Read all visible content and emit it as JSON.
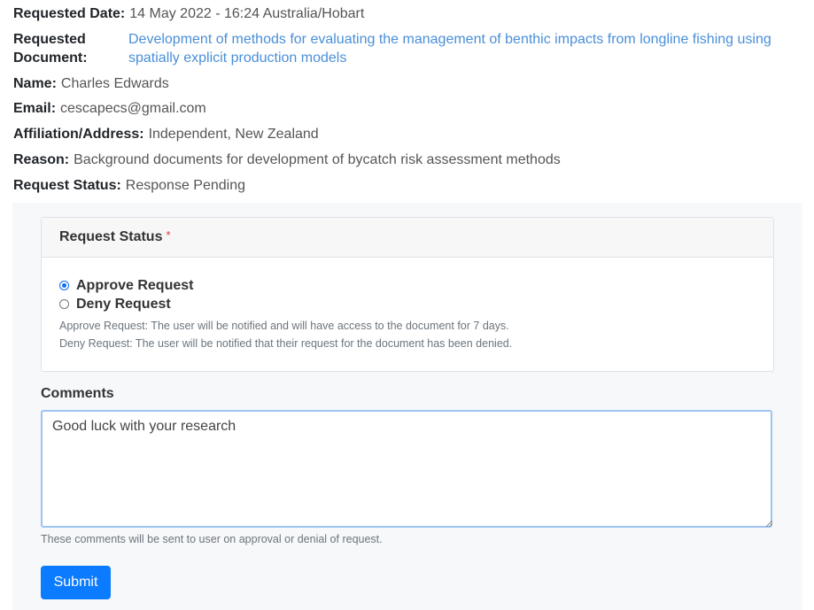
{
  "details": {
    "requested_date_label": "Requested Date:",
    "requested_date_value": "14 May 2022 - 16:24 Australia/Hobart",
    "requested_document_label_line1": "Requested",
    "requested_document_label_line2": "Document:",
    "requested_document_value": "Development of methods for evaluating the management of benthic impacts from longline fishing using spatially explicit production models",
    "name_label": "Name:",
    "name_value": "Charles Edwards",
    "email_label": "Email:",
    "email_value": "cescapecs@gmail.com",
    "affiliation_label": "Affiliation/Address:",
    "affiliation_value": "Independent, New Zealand",
    "reason_label": "Reason:",
    "reason_value": "Background documents for development of bycatch risk assessment methods",
    "status_label": "Request Status:",
    "status_value": "Response Pending"
  },
  "form": {
    "status_card_title": "Request Status",
    "required_mark": "*",
    "options": [
      {
        "label": "Approve Request",
        "checked": true
      },
      {
        "label": "Deny Request",
        "checked": false
      }
    ],
    "help_approve": "Approve Request: The user will be notified and will have access to the document for 7 days.",
    "help_deny": "Deny Request: The user will be notified that their request for the document has been denied.",
    "comments_label": "Comments",
    "comments_value": "Good luck with your research",
    "comments_help": "These comments will be sent to user on approval or denial of request.",
    "submit_label": "Submit"
  },
  "colors": {
    "link": "#4a8fd9",
    "primary": "#0b7bff",
    "required": "#dc3545"
  }
}
